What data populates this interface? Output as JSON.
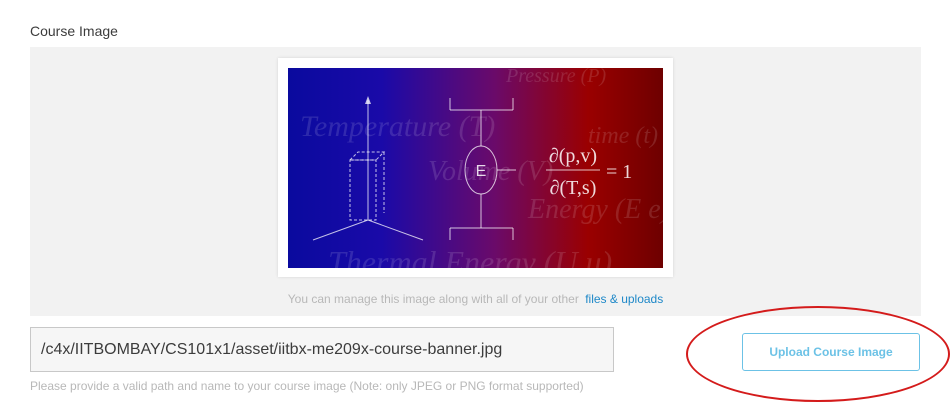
{
  "course_image": {
    "section_label": "Course Image",
    "banner": {
      "bg_words": [
        "Temperature (T)",
        "Volume (V)",
        "Pressure (P)",
        "time (t)",
        "Energy (E e)",
        "Thermal Energy (U u)"
      ],
      "engine_symbol": "E",
      "equation_lhs_num": "∂(p,v)",
      "equation_lhs_den": "∂(T,s)",
      "equation_rhs": "= 1"
    },
    "manage_note": "You can manage this image along with all of your other",
    "manage_link": "files & uploads",
    "path_value": "/c4x/IITBOMBAY/CS101x1/asset/iitbx-me209x-course-banner.jpg",
    "help_text": "Please provide a valid path and name to your course image (Note: only JPEG or PNG format supported)",
    "upload_button_label": "Upload Course Image"
  },
  "colors": {
    "link": "#1e88c8",
    "button_border": "#6cc2e6",
    "annotation_ellipse": "#d41b1b"
  }
}
